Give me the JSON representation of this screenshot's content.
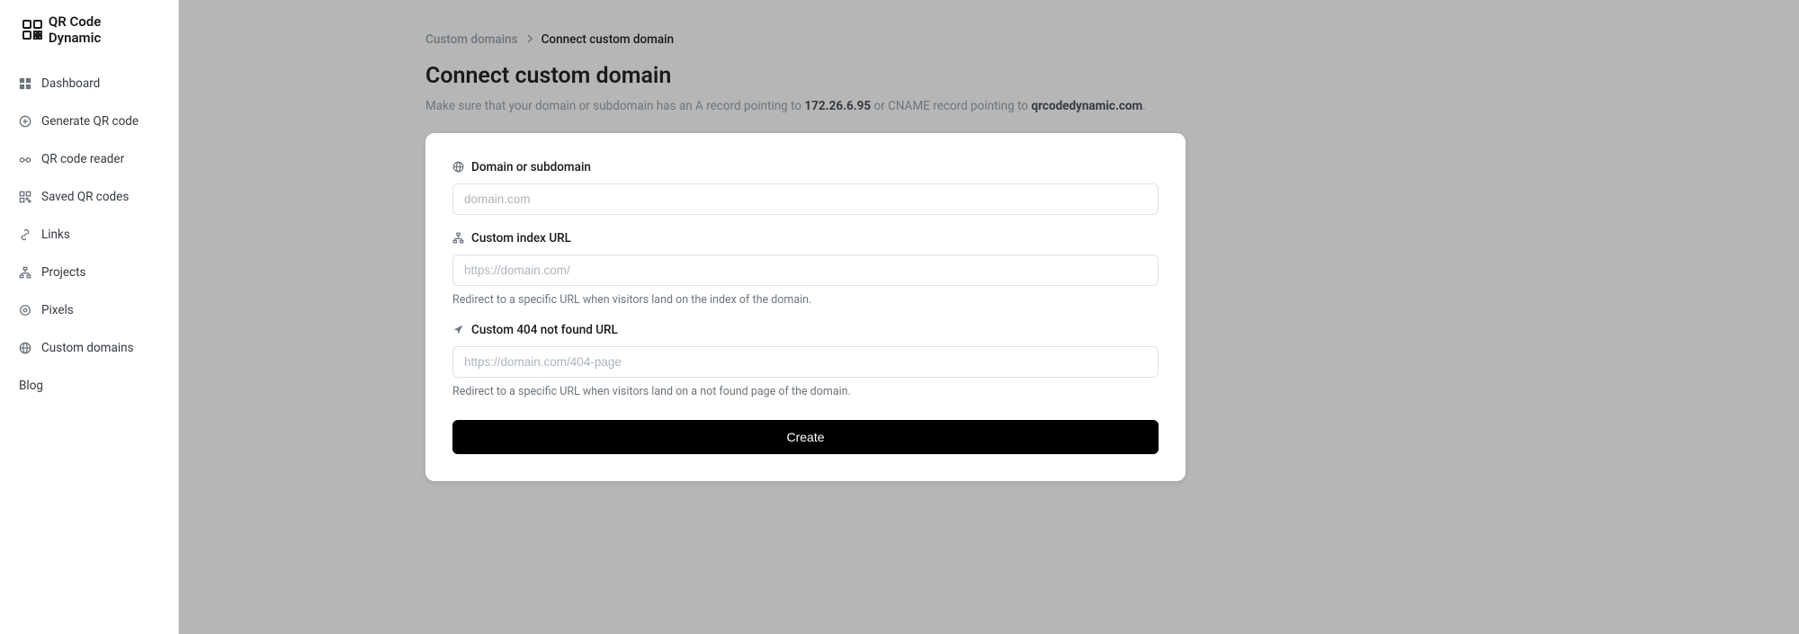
{
  "brand": {
    "name": "QR Code Dynamic"
  },
  "sidebar": {
    "items": [
      {
        "label": "Dashboard"
      },
      {
        "label": "Generate QR code"
      },
      {
        "label": "QR code reader"
      },
      {
        "label": "Saved QR codes"
      },
      {
        "label": "Links"
      },
      {
        "label": "Projects"
      },
      {
        "label": "Pixels"
      },
      {
        "label": "Custom domains"
      }
    ],
    "blog": "Blog"
  },
  "breadcrumb": {
    "link": "Custom domains",
    "current": "Connect custom domain"
  },
  "page": {
    "title": "Connect custom domain",
    "subtitle_prefix": "Make sure that your domain or subdomain has an A record pointing to ",
    "ip": "172.26.6.95",
    "subtitle_mid": " or CNAME record pointing to ",
    "cname": "qrcodedynamic.com",
    "subtitle_suffix": "."
  },
  "form": {
    "domain": {
      "label": "Domain or subdomain",
      "placeholder": "domain.com"
    },
    "index": {
      "label": "Custom index URL",
      "placeholder": "https://domain.com/",
      "help": "Redirect to a specific URL when visitors land on the index of the domain."
    },
    "notfound": {
      "label": "Custom 404 not found URL",
      "placeholder": "https://domain.com/404-page",
      "help": "Redirect to a specific URL when visitors land on a not found page of the domain."
    },
    "submit": "Create"
  }
}
